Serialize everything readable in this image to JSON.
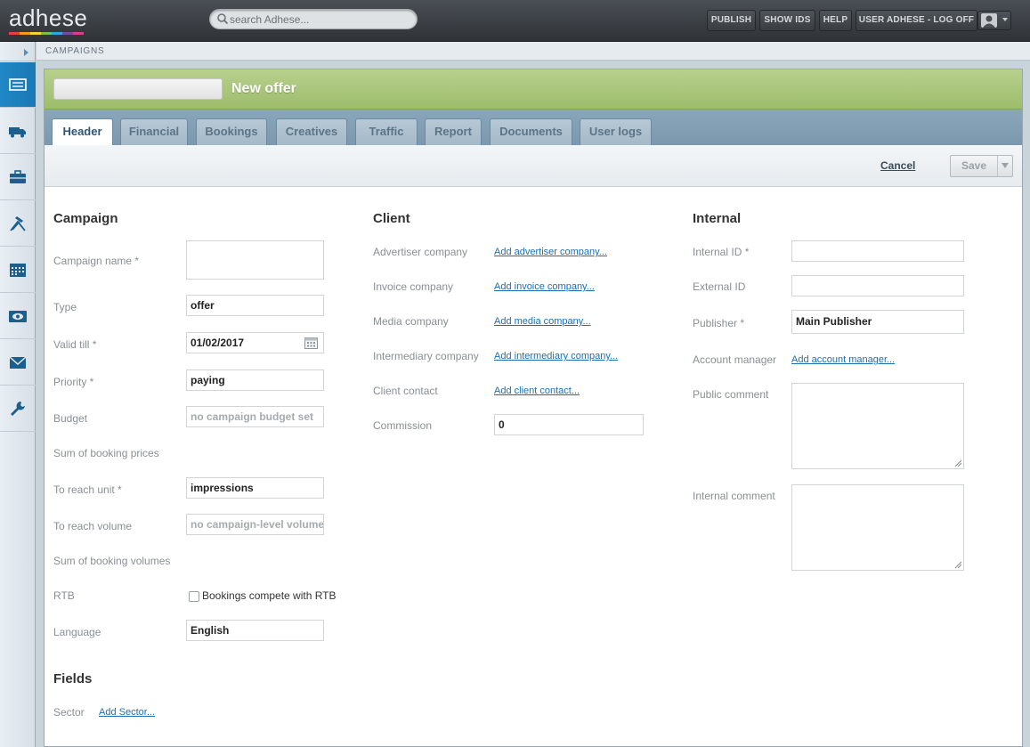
{
  "app": {
    "logo_text": "adhese",
    "logo_colors": [
      "#e8403a",
      "#f39c24",
      "#f7d425",
      "#7ac143",
      "#2aa8e0",
      "#6f4ea0",
      "#d93f8c"
    ],
    "search_placeholder": "search Adhese..."
  },
  "topnav": {
    "publish": "PUBLISH",
    "show_ids": "SHOW IDS",
    "help": "HELP",
    "user": "USER ADHESE - LOG OFF"
  },
  "breadcrumb": "CAMPAIGNS",
  "sidebar": {
    "icons": [
      "campaigns-icon",
      "truck-icon",
      "briefcase-icon",
      "tools-icon",
      "calendar-icon",
      "eye-icon",
      "mail-icon",
      "wrench-icon"
    ],
    "active_index": 0,
    "active_color": "#1f88c6"
  },
  "page": {
    "title": "New offer"
  },
  "tabs": [
    {
      "label": "Header",
      "active": true
    },
    {
      "label": "Financial"
    },
    {
      "label": "Bookings"
    },
    {
      "label": "Creatives"
    },
    {
      "label": "Traffic"
    },
    {
      "label": "Report"
    },
    {
      "label": "Documents"
    },
    {
      "label": "User logs"
    }
  ],
  "actions": {
    "cancel": "Cancel",
    "save": "Save"
  },
  "campaign": {
    "title": "Campaign",
    "name_label": "Campaign name *",
    "name_value": "",
    "type_label": "Type",
    "type_value": "offer",
    "valid_label": "Valid till *",
    "valid_value": "01/02/2017",
    "priority_label": "Priority *",
    "priority_value": "paying",
    "budget_label": "Budget",
    "budget_placeholder": "no campaign budget set",
    "sum_prices_label": "Sum of booking prices",
    "reach_unit_label": "To reach unit *",
    "reach_unit_value": "impressions",
    "reach_volume_label": "To reach volume",
    "reach_volume_placeholder": "no campaign-level volume",
    "sum_volumes_label": "Sum of booking volumes",
    "rtb_label": "RTB",
    "rtb_checkbox_label": "Bookings compete with RTB",
    "language_label": "Language",
    "language_value": "English"
  },
  "fields": {
    "title": "Fields",
    "sector_label": "Sector",
    "sector_link": "Add Sector..."
  },
  "client": {
    "title": "Client",
    "advertiser_label": "Advertiser company",
    "advertiser_link": "Add advertiser company...",
    "invoice_label": "Invoice company",
    "invoice_link": "Add invoice company...",
    "media_label": "Media company",
    "media_link": "Add media company...",
    "intermediary_label": "Intermediary company",
    "intermediary_link": "Add intermediary company...",
    "contact_label": "Client contact",
    "contact_link": "Add client contact...",
    "commission_label": "Commission",
    "commission_value": "0"
  },
  "internal": {
    "title": "Internal",
    "internal_id_label": "Internal ID *",
    "internal_id_value": "",
    "external_id_label": "External ID",
    "external_id_value": "",
    "publisher_label": "Publisher *",
    "publisher_value": "Main Publisher",
    "account_manager_label": "Account manager",
    "account_manager_link": "Add account manager...",
    "public_comment_label": "Public comment",
    "internal_comment_label": "Internal comment"
  }
}
